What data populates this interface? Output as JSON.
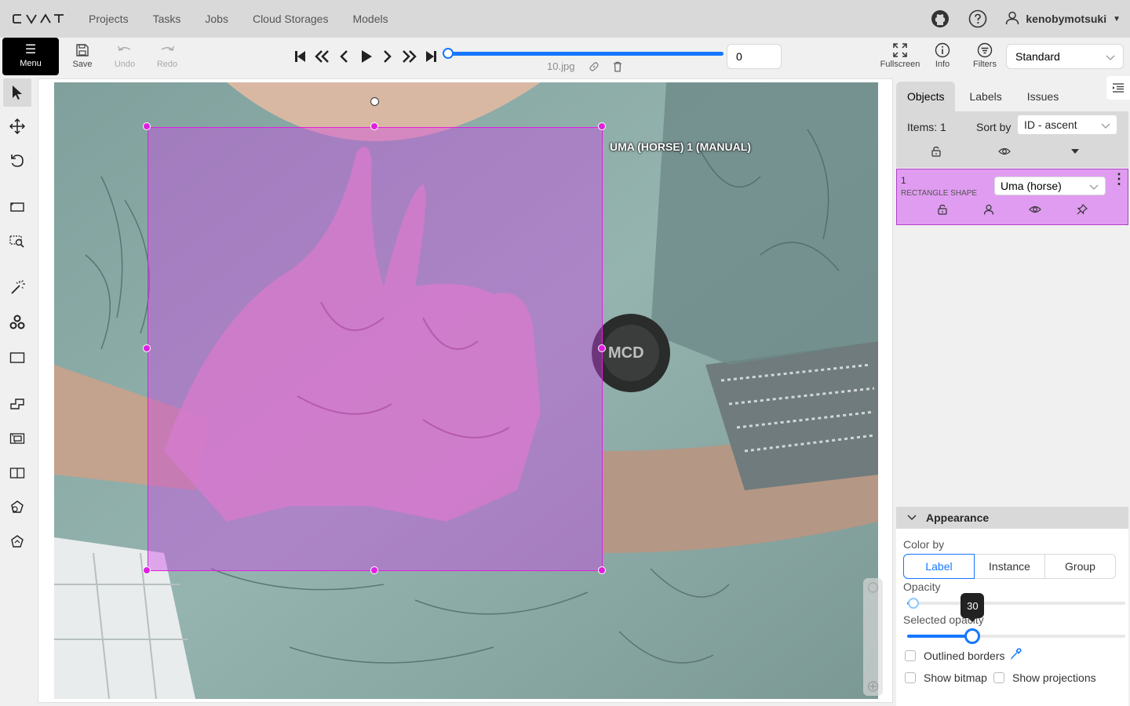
{
  "header": {
    "logo_text": "CVAT",
    "nav": [
      "Projects",
      "Tasks",
      "Jobs",
      "Cloud Storages",
      "Models"
    ],
    "username": "kenobymotsuki"
  },
  "toolbar": {
    "menu_label": "Menu",
    "save_label": "Save",
    "undo_label": "Undo",
    "redo_label": "Redo",
    "frame_name": "10.jpg",
    "frame_number": "0",
    "fullscreen_label": "Fullscreen",
    "info_label": "Info",
    "filters_label": "Filters",
    "workspace": "Standard",
    "frame_progress": 0
  },
  "canvas": {
    "shape_label": "UMA (HORSE) 1 (MANUAL)",
    "shape_color": "#e020e0"
  },
  "sidebar": {
    "tabs": [
      "Objects",
      "Labels",
      "Issues"
    ],
    "items_count": "Items: 1",
    "sort_by_label": "Sort by",
    "sort_value": "ID - ascent",
    "object": {
      "id": "1",
      "type": "RECTANGLE SHAPE",
      "label": "Uma (horse)",
      "color": "#df9cf0"
    },
    "appearance": {
      "title": "Appearance",
      "color_by_label": "Color by",
      "color_by_options": [
        "Label",
        "Instance",
        "Group"
      ],
      "color_by_selected": "Label",
      "opacity_label": "Opacity",
      "opacity_value": 3,
      "selected_opacity_label": "Selected opacity",
      "selected_opacity_value": 30,
      "selected_opacity_tooltip": "30",
      "outlined_borders_label": "Outlined borders",
      "show_bitmap_label": "Show bitmap",
      "show_projections_label": "Show projections"
    }
  },
  "colors": {
    "accent": "#1677ff",
    "header_bg": "#d9d9d9"
  }
}
